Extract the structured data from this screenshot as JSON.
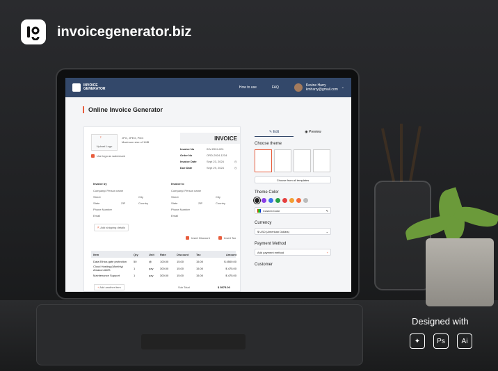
{
  "brand": {
    "name": "invoicegenerator.biz"
  },
  "promo": {
    "designed_with": "Designed with",
    "tools": [
      "Figma",
      "Ps",
      "Ai"
    ]
  },
  "app": {
    "logo_line1": "INVOICE",
    "logo_line2": "GENERATOR",
    "nav": {
      "how_to_use": "How to use",
      "faq": "FAQ"
    },
    "user": {
      "name": "Kevine Harry",
      "email": "kmharry@gmail.com"
    },
    "page_title": "Online Invoice Generator",
    "upload": {
      "label": "Upload Logo",
      "formats": "JPG, JPEG, PNG",
      "max": "Maximum size of 1MB",
      "watermark": "Use logo as watermark"
    },
    "invoice": {
      "title": "INVOICE",
      "fields": [
        {
          "label": "Invoice No",
          "value": "INV-2024-001"
        },
        {
          "label": "Order No",
          "value": "ORD-2024-1234"
        },
        {
          "label": "Invoice Date",
          "value": "Sept 23, 2024"
        },
        {
          "label": "Due Date",
          "value": "Sept 29, 2024"
        }
      ]
    },
    "invoice_by": {
      "title": "Invoice by",
      "company": "Company/ Person name",
      "street": "Street",
      "city": "City",
      "state": "State",
      "zip": "ZIP",
      "country": "Country",
      "phone": "Phone Number",
      "email": "Email"
    },
    "invoice_to": {
      "title": "Invoice to",
      "company": "Company/ Person name",
      "street": "Street",
      "city": "City",
      "state": "State",
      "zip": "ZIP",
      "country": "Country",
      "phone": "Phone Number",
      "email": "Email"
    },
    "shipping": "Add shipping details",
    "insert_discount": "Insert Discount",
    "insert_tax": "Insert Tax",
    "table": {
      "headers": [
        "Item",
        "Qty",
        "Unit",
        "Rate",
        "Discount",
        "Tax",
        "Amount"
      ],
      "rows": [
        [
          "Data Ethics gate protection",
          "50",
          "@",
          "100.00",
          "15.00",
          "15.00",
          "$ 4500.00"
        ],
        [
          "Cloud Hosting (Monthly) Amazon AWS",
          "1",
          "pay",
          "300.00",
          "15.00",
          "15.00",
          "$ 475.00"
        ],
        [
          "Maintenance Support",
          "1",
          "pay",
          "300.00",
          "15.00",
          "15.00",
          "$ 475.00"
        ]
      ],
      "add_item": "Add another item",
      "subtotal_label": "Sub Total",
      "subtotal": "$ 5975.00"
    },
    "side": {
      "tabs": [
        "Edit",
        "Preview"
      ],
      "choose_theme": "Choose theme",
      "choose_all": "Choose from all templates",
      "theme_color": "Theme Color",
      "custom_color": "Custom Color",
      "colors": [
        "#222222",
        "#8a3ee6",
        "#3d72e8",
        "#26a148",
        "#e53f3f",
        "#f29f33",
        "#f56a3c",
        "#bbbbbb"
      ],
      "currency": "Currency",
      "currency_value": "$ USD (American Dollars)",
      "payment": "Payment Method",
      "payment_value": "Add payment method",
      "customer": "Customer"
    }
  }
}
